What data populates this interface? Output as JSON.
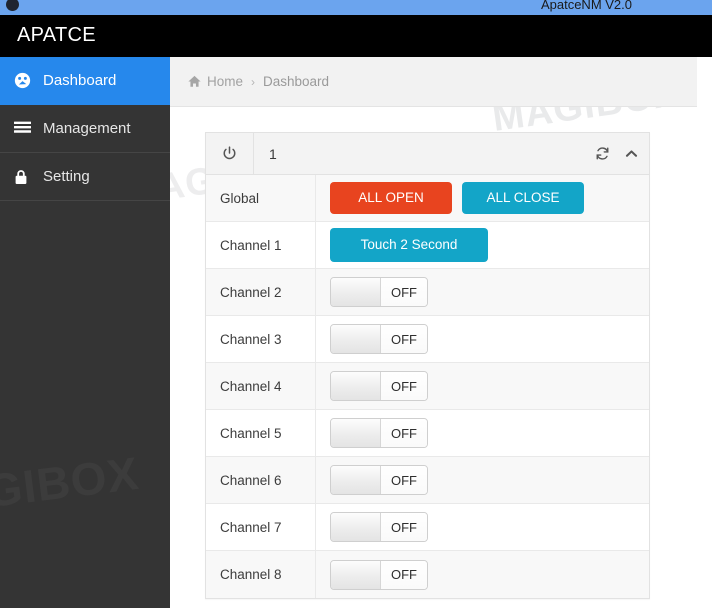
{
  "window": {
    "title": "ApatceNM V2.0",
    "app_icon": "app-dot-icon"
  },
  "header": {
    "brand": "APATCE"
  },
  "sidebar": {
    "items": [
      {
        "label": "Dashboard",
        "icon": "dashboard-icon",
        "active": true
      },
      {
        "label": "Management",
        "icon": "list-icon",
        "active": false
      },
      {
        "label": "Setting",
        "icon": "lock-icon",
        "active": false
      }
    ],
    "watermark": "GIBOX"
  },
  "breadcrumb": {
    "home_icon": "home-icon",
    "home": "Home",
    "separator": "›",
    "current": "Dashboard"
  },
  "watermarks": {
    "a": "MAGIBOX",
    "b": "MAGIBOX",
    "c": "MAGIBOX"
  },
  "panel": {
    "power_icon": "power-icon",
    "title": "1",
    "refresh_icon": "refresh-icon",
    "collapse_icon": "chevron-up-icon",
    "rows": [
      {
        "label": "Global",
        "type": "buttons",
        "buttons": [
          {
            "text": "ALL OPEN",
            "style": "btn-open"
          },
          {
            "text": "ALL CLOSE",
            "style": "btn-close"
          }
        ]
      },
      {
        "label": "Channel 1",
        "type": "button",
        "button": {
          "text": "Touch 2 Second",
          "style": "btn-touch"
        }
      },
      {
        "label": "Channel 2",
        "type": "switch",
        "state": "OFF"
      },
      {
        "label": "Channel 3",
        "type": "switch",
        "state": "OFF"
      },
      {
        "label": "Channel 4",
        "type": "switch",
        "state": "OFF"
      },
      {
        "label": "Channel 5",
        "type": "switch",
        "state": "OFF"
      },
      {
        "label": "Channel 6",
        "type": "switch",
        "state": "OFF"
      },
      {
        "label": "Channel 7",
        "type": "switch",
        "state": "OFF"
      },
      {
        "label": "Channel 8",
        "type": "switch",
        "state": "OFF"
      }
    ]
  },
  "colors": {
    "accent_blue": "#2688ec",
    "danger_red": "#e8441f",
    "info_cyan": "#13a5c8",
    "sidebar_dark": "#343434",
    "titlebar_blue": "#6ba4ee"
  }
}
